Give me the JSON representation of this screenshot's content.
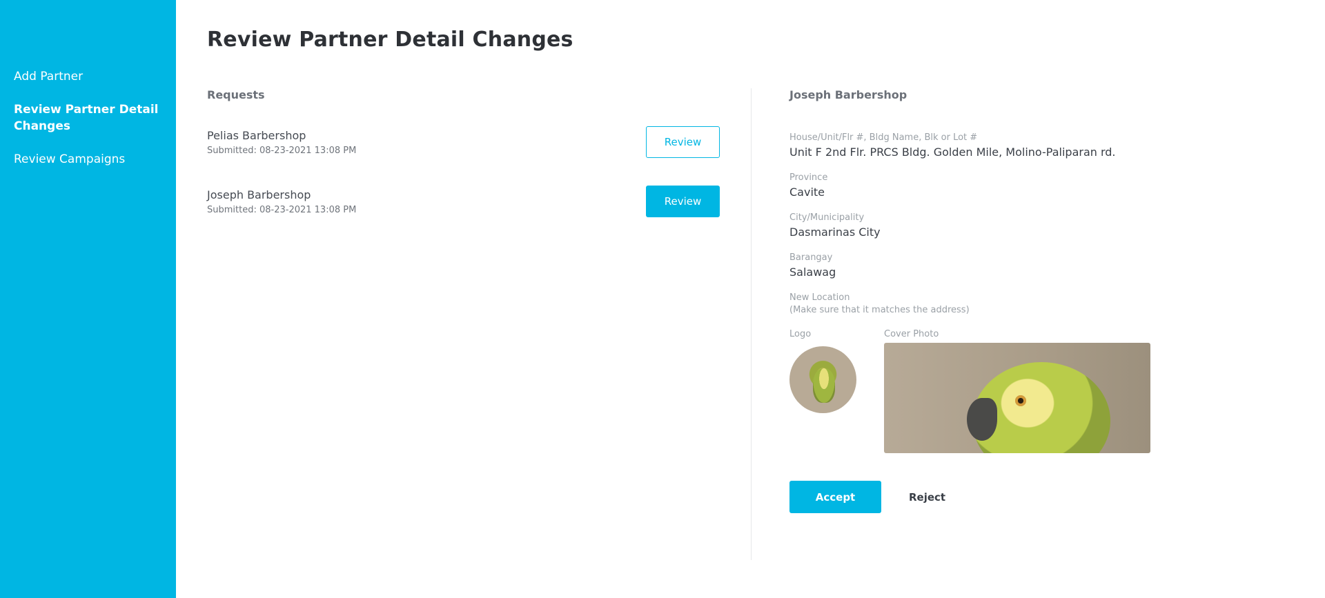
{
  "sidebar": {
    "items": [
      {
        "label": "Add Partner"
      },
      {
        "label": "Review Partner Detail Changes"
      },
      {
        "label": "Review Campaigns"
      }
    ]
  },
  "page": {
    "title": "Review Partner Detail Changes"
  },
  "requests": {
    "heading": "Requests",
    "items": [
      {
        "name": "Pelias Barbershop",
        "submitted": "Submitted: 08-23-2021 13:08 PM",
        "button_label": "Review"
      },
      {
        "name": "Joseph Barbershop",
        "submitted": "Submitted: 08-23-2021 13:08 PM",
        "button_label": "Review"
      }
    ]
  },
  "detail": {
    "heading": "Joseph Barbershop",
    "fields": [
      {
        "label": "House/Unit/Flr #, Bldg Name, Blk or Lot #",
        "value": "Unit F 2nd Flr. PRCS Bldg. Golden Mile, Molino-Paliparan rd."
      },
      {
        "label": "Province",
        "value": "Cavite"
      },
      {
        "label": "City/Municipality",
        "value": "Dasmarinas City"
      },
      {
        "label": "Barangay",
        "value": "Salawag"
      }
    ],
    "new_location_label": "New Location",
    "new_location_note": "(Make sure that it matches the address)",
    "logo_label": "Logo",
    "cover_label": "Cover Photo",
    "accept_label": "Accept",
    "reject_label": "Reject"
  },
  "colors": {
    "accent": "#00b6e3",
    "text": "#3a3f47",
    "muted": "#9aa0a6"
  }
}
